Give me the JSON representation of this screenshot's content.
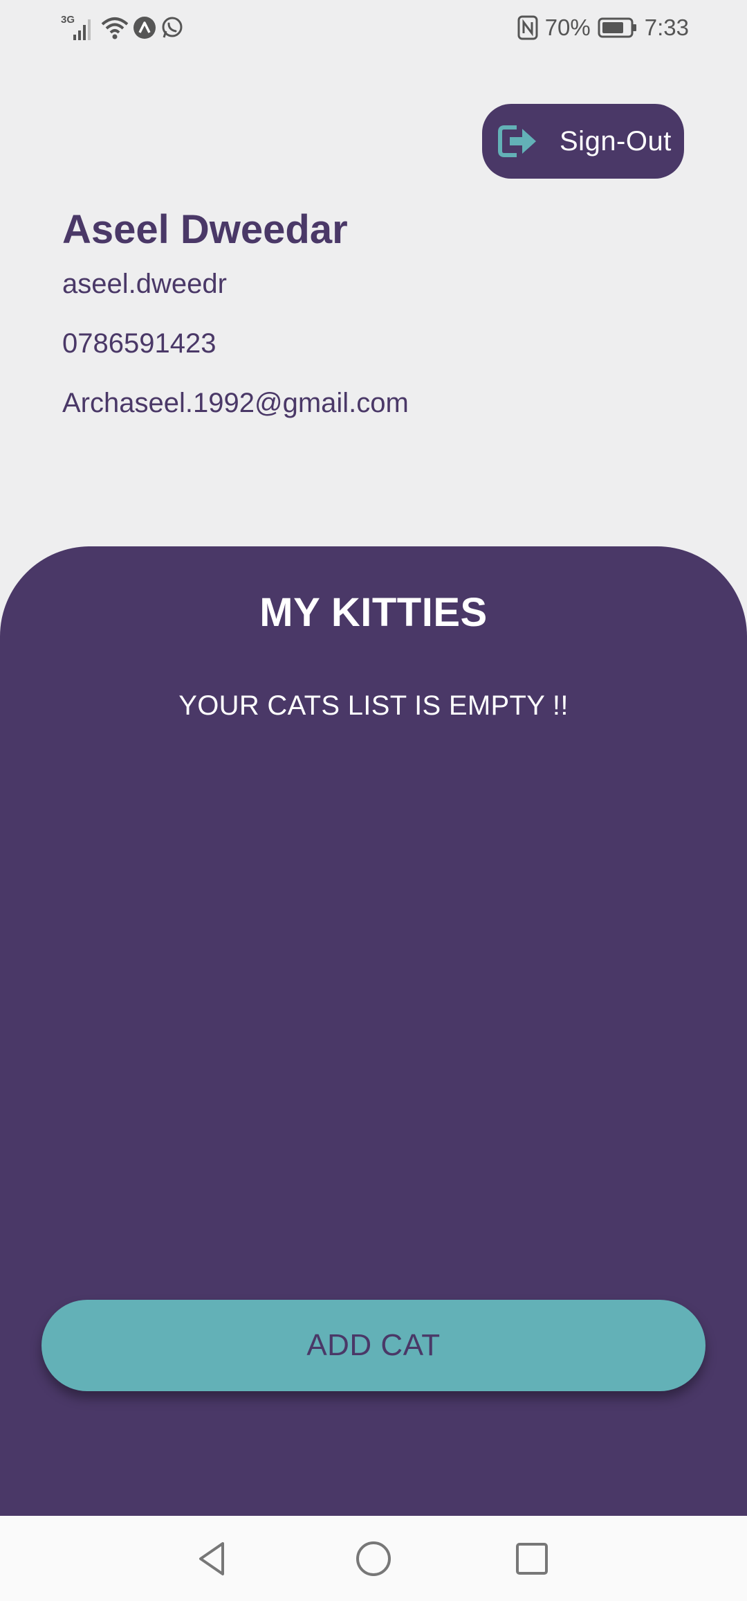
{
  "status_bar": {
    "network_label": "3G",
    "battery_percent": "70%",
    "time": "7:33",
    "icons": [
      "signal-icon",
      "wifi-icon",
      "app-notification-icon",
      "whatsapp-icon",
      "nfc-icon",
      "battery-icon"
    ]
  },
  "header": {
    "sign_out_label": "Sign-Out",
    "sign_out_icon": "sign-out-icon"
  },
  "profile": {
    "name": "Aseel Dweedar",
    "username": "aseel.dweedr",
    "phone": "0786591423",
    "email": "Archaseel.1992@gmail.com"
  },
  "kitties": {
    "title": "MY KITTIES",
    "empty_message": "YOUR CATS LIST IS EMPTY !!",
    "add_button_label": "ADD CAT"
  },
  "nav": {
    "icons": [
      "back-icon",
      "home-icon",
      "recents-icon"
    ]
  },
  "colors": {
    "primary": "#4a3867",
    "accent": "#63b1b7",
    "background": "#eeeeef"
  }
}
